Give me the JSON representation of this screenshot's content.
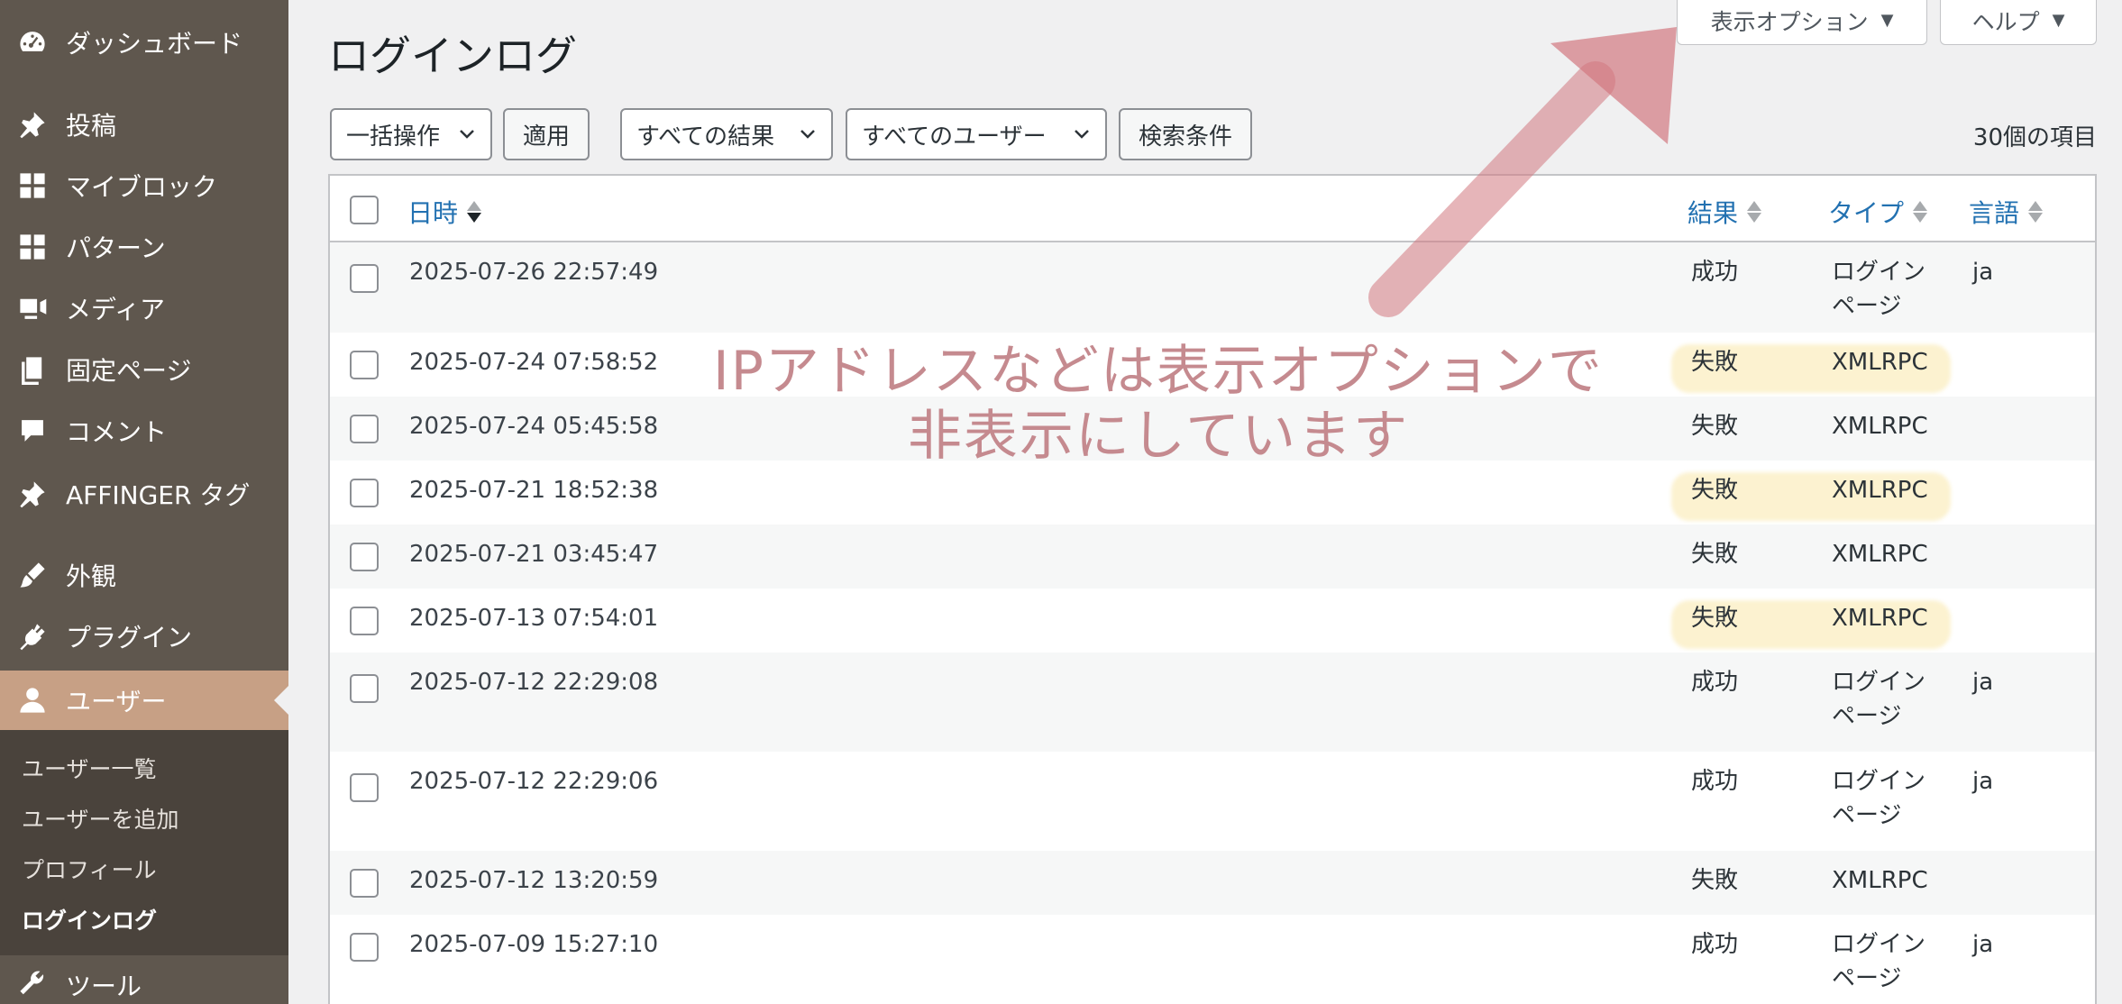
{
  "sidebar": {
    "items": [
      {
        "label": "ダッシュボード",
        "icon": "dashboard-icon"
      },
      {
        "label": "投稿",
        "icon": "pin-icon"
      },
      {
        "label": "マイブロック",
        "icon": "grid-icon"
      },
      {
        "label": "パターン",
        "icon": "grid-icon"
      },
      {
        "label": "メディア",
        "icon": "media-icon"
      },
      {
        "label": "固定ページ",
        "icon": "pages-icon"
      },
      {
        "label": "コメント",
        "icon": "comment-icon"
      },
      {
        "label": "AFFINGER タグ",
        "icon": "pin-icon"
      },
      {
        "label": "外観",
        "icon": "brush-icon"
      },
      {
        "label": "プラグイン",
        "icon": "plug-icon"
      },
      {
        "label": "ユーザー",
        "icon": "user-icon"
      },
      {
        "label": "ツール",
        "icon": "wrench-icon"
      }
    ],
    "submenu": [
      {
        "label": "ユーザー一覧"
      },
      {
        "label": "ユーザーを追加"
      },
      {
        "label": "プロフィール"
      },
      {
        "label": "ログインログ"
      }
    ]
  },
  "header": {
    "title": "ログインログ",
    "screen_options": "表示オプション",
    "help": "ヘルプ"
  },
  "toolbar": {
    "bulk_action": "一括操作",
    "apply": "適用",
    "filter_result": "すべての結果",
    "filter_user": "すべてのユーザー",
    "search_filter": "検索条件",
    "items_count": "30個の項目"
  },
  "table": {
    "columns": {
      "date": "日時",
      "result": "結果",
      "type": "タイプ",
      "lang": "言語"
    },
    "rows": [
      {
        "date": "2025-07-26 22:57:49",
        "result": "成功",
        "type_line1": "ログイン",
        "type_line2": "ページ",
        "lang": "ja"
      },
      {
        "date": "2025-07-24 07:58:52",
        "result": "失敗",
        "type_line1": "XMLRPC",
        "type_line2": "",
        "lang": ""
      },
      {
        "date": "2025-07-24 05:45:58",
        "result": "失敗",
        "type_line1": "XMLRPC",
        "type_line2": "",
        "lang": ""
      },
      {
        "date": "2025-07-21 18:52:38",
        "result": "失敗",
        "type_line1": "XMLRPC",
        "type_line2": "",
        "lang": ""
      },
      {
        "date": "2025-07-21 03:45:47",
        "result": "失敗",
        "type_line1": "XMLRPC",
        "type_line2": "",
        "lang": ""
      },
      {
        "date": "2025-07-13 07:54:01",
        "result": "失敗",
        "type_line1": "XMLRPC",
        "type_line2": "",
        "lang": ""
      },
      {
        "date": "2025-07-12 22:29:08",
        "result": "成功",
        "type_line1": "ログイン",
        "type_line2": "ページ",
        "lang": "ja"
      },
      {
        "date": "2025-07-12 22:29:06",
        "result": "成功",
        "type_line1": "ログイン",
        "type_line2": "ページ",
        "lang": "ja"
      },
      {
        "date": "2025-07-12 13:20:59",
        "result": "失敗",
        "type_line1": "XMLRPC",
        "type_line2": "",
        "lang": ""
      },
      {
        "date": "2025-07-09 15:27:10",
        "result": "成功",
        "type_line1": "ログイン",
        "type_line2": "ページ",
        "lang": "ja"
      }
    ]
  },
  "annotation": {
    "line1": "IPアドレスなどは表示オプションで",
    "line2": "非表示にしています",
    "color": "#c58a8f"
  },
  "colors": {
    "sidebar": "#5f574e",
    "active": "#c7a085",
    "link": "#2271b1"
  }
}
